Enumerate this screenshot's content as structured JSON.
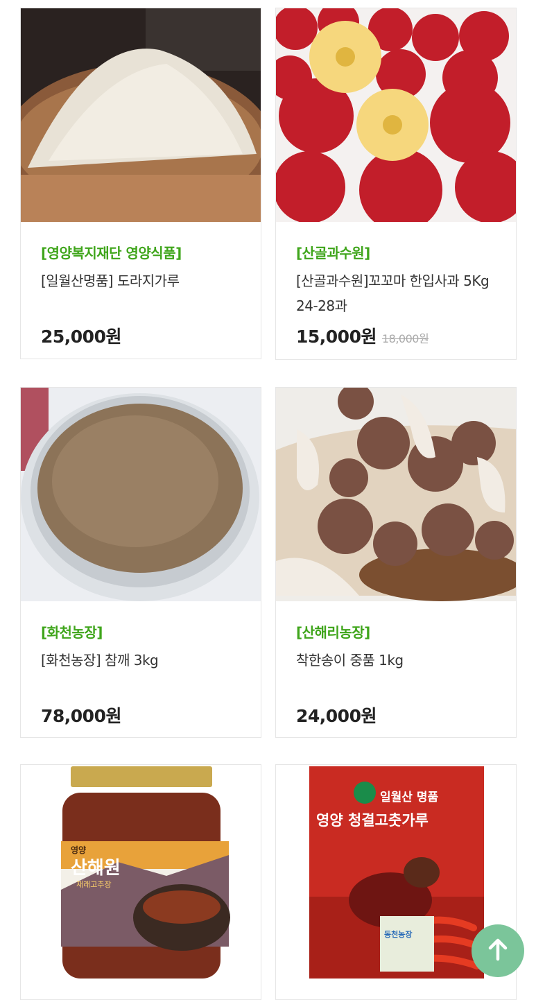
{
  "products": [
    {
      "seller": "[영양복지재단 영양식품]",
      "name": "[일월산명품] 도라지가루",
      "price": "25,000원",
      "old_price": ""
    },
    {
      "seller": "[산골과수원]",
      "name": "[산골과수원]꼬꼬마 한입사과 5Kg 24-28과",
      "price": "15,000원",
      "old_price": "18,000원"
    },
    {
      "seller": "[화천농장]",
      "name": "[화천농장] 참깨 3kg",
      "price": "78,000원",
      "old_price": ""
    },
    {
      "seller": "[산해리농장]",
      "name": "착한송이 중품 1kg",
      "price": "24,000원",
      "old_price": ""
    },
    {
      "seller": "",
      "name": "",
      "price": "",
      "old_price": "",
      "label_top": "영양",
      "label_main": "산해원",
      "label_sub": "재래고추장"
    },
    {
      "seller": "",
      "name": "",
      "price": "",
      "old_price": "",
      "brand": "일월산 명품",
      "title": "영양 청결고춧가루",
      "farm": "동천농장"
    }
  ],
  "colors": {
    "seller": "#3fa51b",
    "scroll_top_bg": "#7bc59a"
  },
  "scroll_top_icon": "arrow-up-icon"
}
